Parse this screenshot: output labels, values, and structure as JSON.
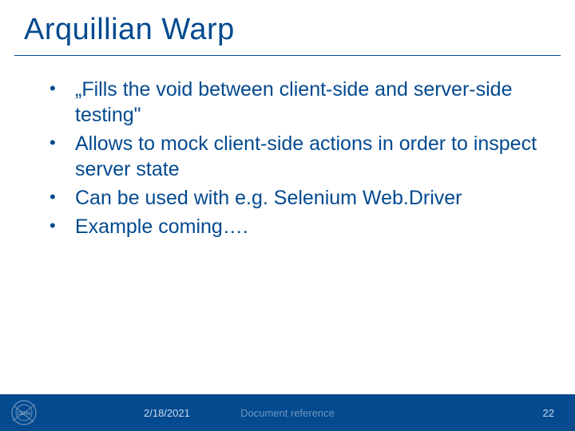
{
  "title": "Arquillian Warp",
  "bullets": [
    "„Fills the void between client-side and server-side testing\"",
    "Allows to mock client-side actions in order to inspect server state",
    "Can be used with e.g. Selenium Web.Driver",
    "Example coming…."
  ],
  "footer": {
    "date": "2/18/2021",
    "docref": "Document reference",
    "page": "22",
    "logo_label": "CERN"
  },
  "colors": {
    "brand": "#034a8f"
  }
}
